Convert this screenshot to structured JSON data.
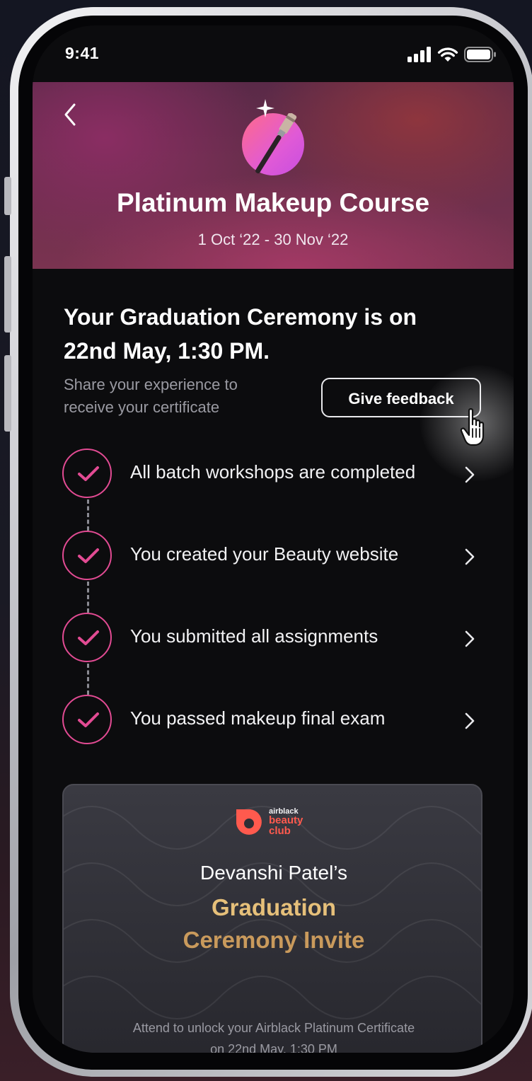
{
  "status_bar": {
    "time": "9:41",
    "icons": [
      "cellular-signal-icon",
      "wifi-icon",
      "battery-icon"
    ]
  },
  "header": {
    "back_icon": "chevron-left-icon",
    "course_icon": "makeup-brush-icon",
    "title": "Platinum Makeup Course",
    "dates": "1 Oct ‘22 - 30 Nov ‘22"
  },
  "ceremony": {
    "heading": "Your Graduation Ceremony is on 22nd May, 1:30 PM.",
    "subtext": "Share your experience to receive your certificate",
    "feedback_button": "Give feedback"
  },
  "milestones": [
    {
      "label": "All batch workshops are completed",
      "done": true
    },
    {
      "label": "You created your Beauty website",
      "done": true
    },
    {
      "label": "You submitted all assignments",
      "done": true
    },
    {
      "label": "You passed makeup final exam",
      "done": true
    }
  ],
  "invite": {
    "brand_small": "airblack",
    "brand_line1": "beauty",
    "brand_line2": "club",
    "name": "Devanshi Patel’s",
    "title_line1": "Graduation",
    "title_line2": "Ceremony Invite",
    "note_line1": "Attend to unlock your Airblack Platinum Certificate",
    "note_line2": "on 22nd May, 1:30 PM"
  },
  "colors": {
    "accent_pink": "#e24b93",
    "gold": "#e6c07a",
    "brand_red": "#ff5a4e",
    "background": "#0c0c0e"
  }
}
